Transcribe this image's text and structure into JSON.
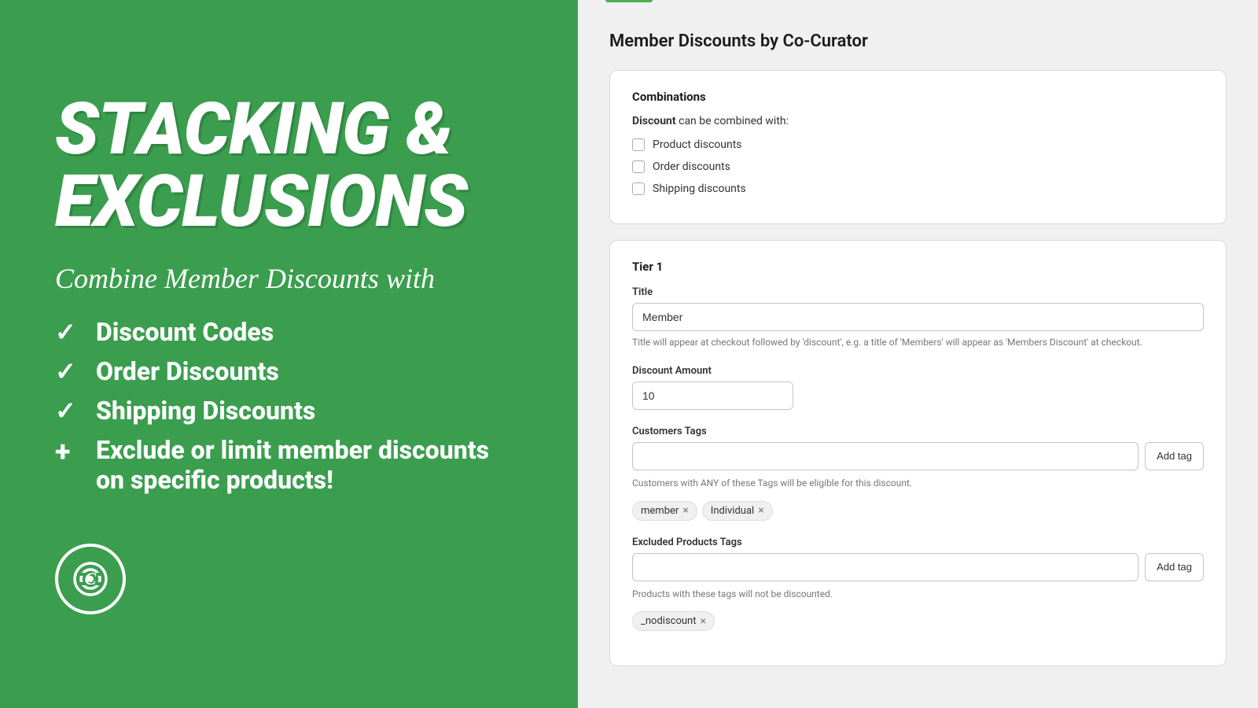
{
  "left": {
    "headline": "STACKING &\nEXCLUSIONS",
    "subtitle": "Combine Member Discounts with",
    "features": [
      {
        "prefix": "✓",
        "text": "Discount Codes",
        "type": "check"
      },
      {
        "prefix": "✓",
        "text": "Order Discounts",
        "type": "check"
      },
      {
        "prefix": "✓",
        "text": "Shipping Discounts",
        "type": "check"
      },
      {
        "prefix": "+",
        "text": "Exclude or limit member discounts on specific products!",
        "type": "plus"
      }
    ]
  },
  "right": {
    "page_title": "Member Discounts by Co-Curator",
    "combinations_card": {
      "title": "Combinations",
      "label_text": "can be combined with:",
      "label_bold": "Discount",
      "checkboxes": [
        {
          "label": "Product discounts",
          "checked": false
        },
        {
          "label": "Order discounts",
          "checked": false
        },
        {
          "label": "Shipping discounts",
          "checked": false
        }
      ]
    },
    "tier_card": {
      "tier_label": "Tier 1",
      "title_label": "Title",
      "title_value": "Member",
      "title_hint": "Title will appear at checkout followed by 'discount', e.g. a title of 'Members' will appear as 'Members Discount' at checkout.",
      "discount_amount_label": "Discount Amount",
      "discount_amount_value": "10",
      "discount_amount_suffix": "%",
      "customers_tags_label": "Customers Tags",
      "customers_tags_placeholder": "",
      "customers_tags_hint": "Customers with ANY of these Tags will be eligible for this discount.",
      "customers_tags_add_btn": "Add tag",
      "customer_tags": [
        {
          "label": "member"
        },
        {
          "label": "Individual"
        }
      ],
      "excluded_products_label": "Excluded Products Tags",
      "excluded_products_placeholder": "",
      "excluded_products_add_btn": "Add tag",
      "excluded_products_hint": "Products with these tags will not be discounted.",
      "excluded_tags": [
        {
          "label": "_nodiscount"
        }
      ]
    }
  }
}
